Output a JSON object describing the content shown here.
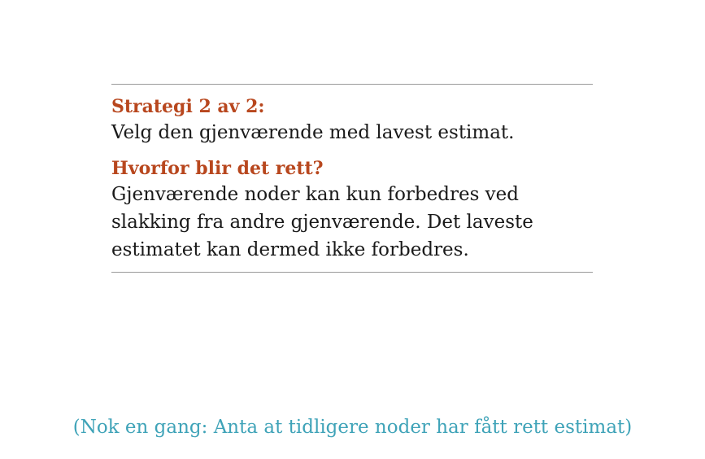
{
  "box": {
    "strategy_heading": "Strategi 2 av 2:",
    "strategy_text": "Velg den gjenværende med lavest estimat.",
    "why_heading": "Hvorfor blir det rett?",
    "why_lines": [
      "Gjenværende noder kan kun forbedres ved",
      "slakking fra andre gjenværende.  Det laveste",
      "estimatet kan dermed ikke forbedres."
    ]
  },
  "note": "(Nok en gang:  Anta at tidligere noder har fått rett estimat)",
  "colors": {
    "heading": "#b8471e",
    "note": "#3fa3b8",
    "rule": "#9a9a9a"
  }
}
